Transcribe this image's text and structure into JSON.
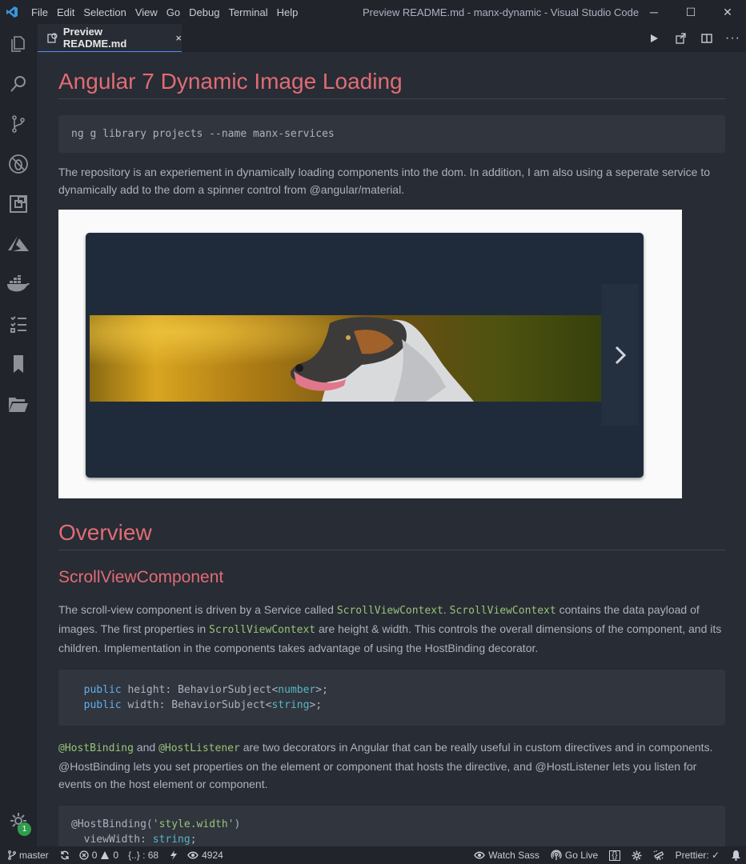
{
  "window": {
    "title": "Preview README.md - manx-dynamic - Visual Studio Code",
    "menu": [
      "File",
      "Edit",
      "Selection",
      "View",
      "Go",
      "Debug",
      "Terminal",
      "Help"
    ]
  },
  "tab": {
    "label": "Preview README.md",
    "close": "×"
  },
  "activity": {
    "badge": "1"
  },
  "doc": {
    "h1": "Angular 7 Dynamic Image Loading",
    "cmd": "ng g library projects --name manx-services",
    "intro": "The repository is an experiement in dynamically loading components into the dom. In addition, I am also using a seperate service to dynamically add to the dom a spinner control from @angular/material.",
    "overview": "Overview",
    "h2": "ScrollViewComponent",
    "p2a": "The scroll-view component is driven by a Service called ",
    "p2code1": "ScrollViewContext",
    "p2b": ". ",
    "p2code2": "ScrollViewContext",
    "p2c": " contains the data payload of images. The first properties in ",
    "p2code3": "ScrollViewContext",
    "p2d": " are height & width. This controls the overall dimensions of the component, and its children. Implementation in the components takes advantage of using the HostBinding decorator.",
    "code1": {
      "kw": "public",
      "l1a": " height: BehaviorSubject<",
      "l1t": "number",
      "l1b": ">;",
      "l2a": " width: BehaviorSubject<",
      "l2t": "string",
      "l2b": ">;"
    },
    "p3code1": "@HostBinding",
    "p3a": " and ",
    "p3code2": "@HostListener",
    "p3b": " are two decorators in Angular that can be really useful in custom directives and in components. @HostBinding lets you set properties on the element or component that hosts the directive, and @HostListener lets you listen for events on the host element or component.",
    "code2": {
      "l1a": "@HostBinding(",
      "l1s": "'style.width'",
      "l1b": ")",
      "l2a": "  viewWidth: ",
      "l2t": "string",
      "l2b": ";"
    }
  },
  "status": {
    "branch": "master",
    "errors": "0",
    "warnings": "0",
    "braces": "{..} : 68",
    "views": "4924",
    "watch_sass": "Watch Sass",
    "go_live": "Go Live",
    "prettier": "Prettier: ✓"
  }
}
